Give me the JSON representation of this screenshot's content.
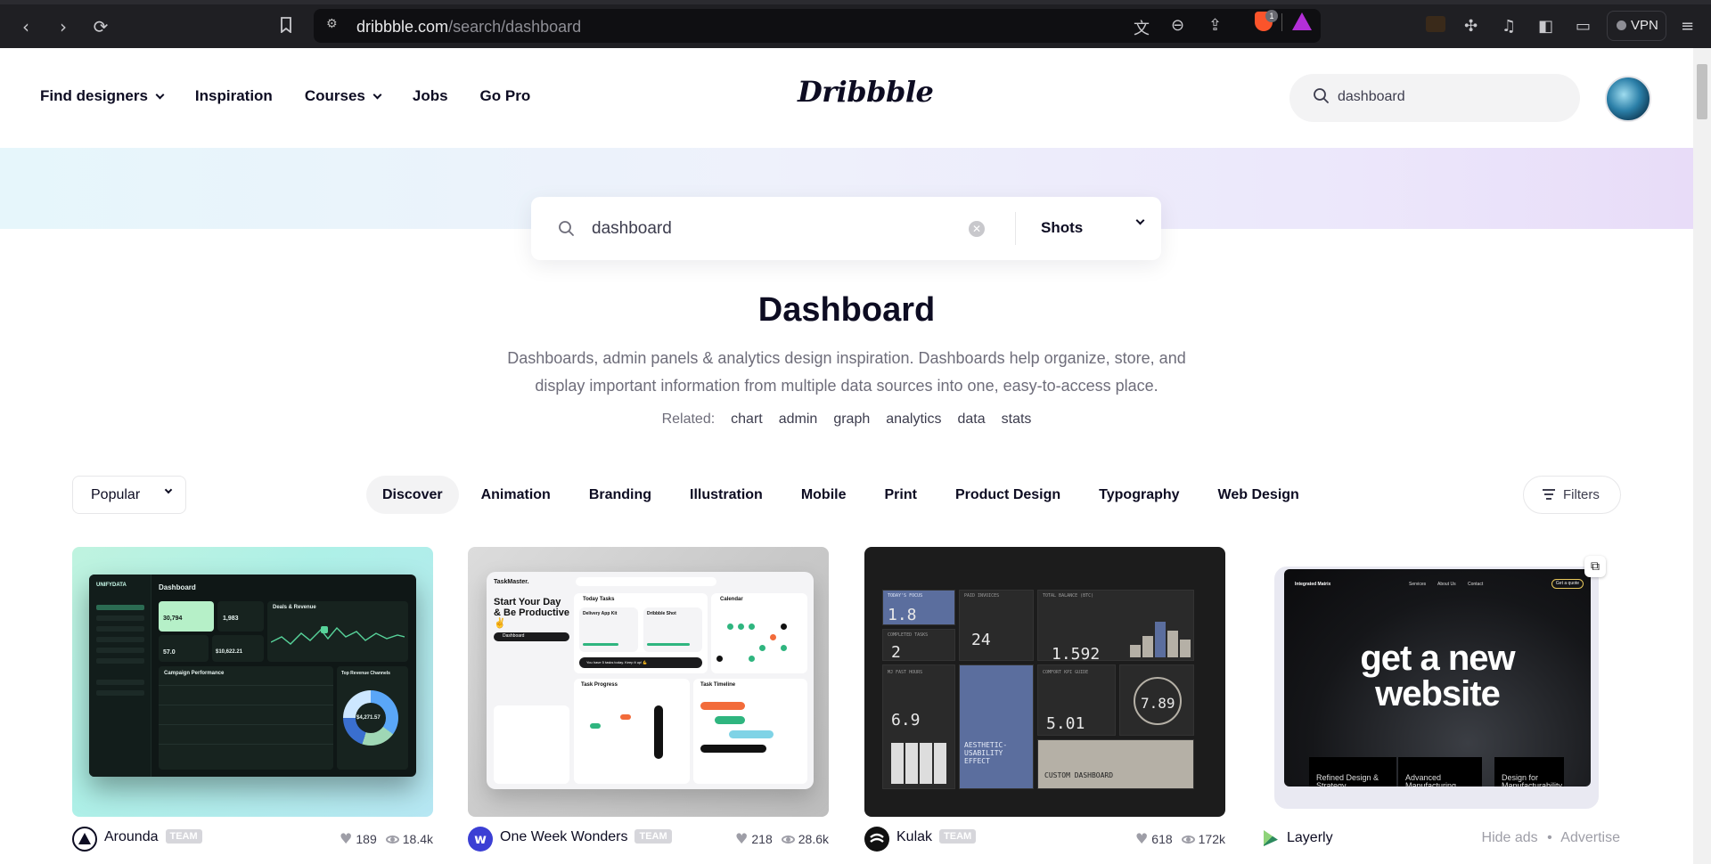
{
  "browser": {
    "url_domain": "dribbble.com",
    "url_path": "/search/dashboard",
    "brave_badge": "1",
    "vpn_label": "VPN"
  },
  "header": {
    "nav": [
      {
        "label": "Find designers",
        "dropdown": true
      },
      {
        "label": "Inspiration",
        "dropdown": false
      },
      {
        "label": "Courses",
        "dropdown": true
      },
      {
        "label": "Jobs",
        "dropdown": false
      },
      {
        "label": "Go Pro",
        "dropdown": false
      }
    ],
    "logo": "Dribbble",
    "search_value": "dashboard"
  },
  "hero": {
    "search_value": "dashboard",
    "search_type": "Shots",
    "title": "Dashboard",
    "description": "Dashboards, admin panels & analytics design inspiration. Dashboards help organize, store, and display important information from multiple data sources into one, easy-to-access place.",
    "related_label": "Related:",
    "related": [
      "chart",
      "admin",
      "graph",
      "analytics",
      "data",
      "stats"
    ]
  },
  "filters": {
    "sort": "Popular",
    "categories": [
      "Discover",
      "Animation",
      "Branding",
      "Illustration",
      "Mobile",
      "Print",
      "Product Design",
      "Typography",
      "Web Design"
    ],
    "active_category": "Discover",
    "filters_label": "Filters"
  },
  "shots": [
    {
      "author": "Arounda",
      "badge": "TEAM",
      "likes": "189",
      "views": "18.4k"
    },
    {
      "author": "One Week Wonders",
      "badge": "TEAM",
      "likes": "218",
      "views": "28.6k"
    },
    {
      "author": "Kulak",
      "badge": "TEAM",
      "likes": "618",
      "views": "172k"
    }
  ],
  "shot_details": {
    "s1": {
      "brand": "UNIFYDATA",
      "title": "Dashboard",
      "visitors": "30,794",
      "contacts": "1,983",
      "deals": "Deals & Revenue",
      "campaign": "Campaign Performance",
      "channels": "Top Revenue Channels",
      "attr": "57.0",
      "revenue": "$10,622.21",
      "donut_value": "$4,271.57"
    },
    "s2": {
      "brand": "TaskMaster.",
      "title": "Start Your Day & Be Productive ✌",
      "today": "Today Tasks",
      "calendar": "Calendar",
      "delivery": "Delivery App Kit",
      "dribbble": "Dribbble Shot",
      "progress": "Task Progress",
      "timeline": "Task Timeline",
      "note": "You have 5 tasks today. Keep it up! 💪",
      "dashboard": "Dashboard"
    },
    "s3": {
      "focus": "1.8",
      "invoices": "24",
      "balance": "1.592",
      "tasks": "2",
      "hours": "6.9",
      "kpi": "5.01",
      "rate": "7.89",
      "effect": "AESTHETIC-USABILITY EFFECT",
      "custom": "CUSTOM DASHBOARD",
      "l_focus": "TODAY'S FOCUS",
      "l_inv": "PAID INVOICES",
      "l_bal": "TOTAL BALANCE (BTC)",
      "l_tasks": "COMPLETED TASKS",
      "l_hours": "MJ FAST HOURS",
      "l_kpi": "COMFORT KPI GUIDE"
    }
  },
  "ad": {
    "headline_1": "get a new",
    "headline_2": "website",
    "brand": "Integrated Matrix",
    "nav": [
      "Services",
      "About Us",
      "Contact"
    ],
    "quote": "Get a quote",
    "cards": [
      "Refined Design & Strategy",
      "Advanced Manufacturing",
      "Design for Manufacturability"
    ],
    "advertiser": "Layerly",
    "hide_ads": "Hide ads",
    "separator": "•",
    "advertise": "Advertise"
  }
}
